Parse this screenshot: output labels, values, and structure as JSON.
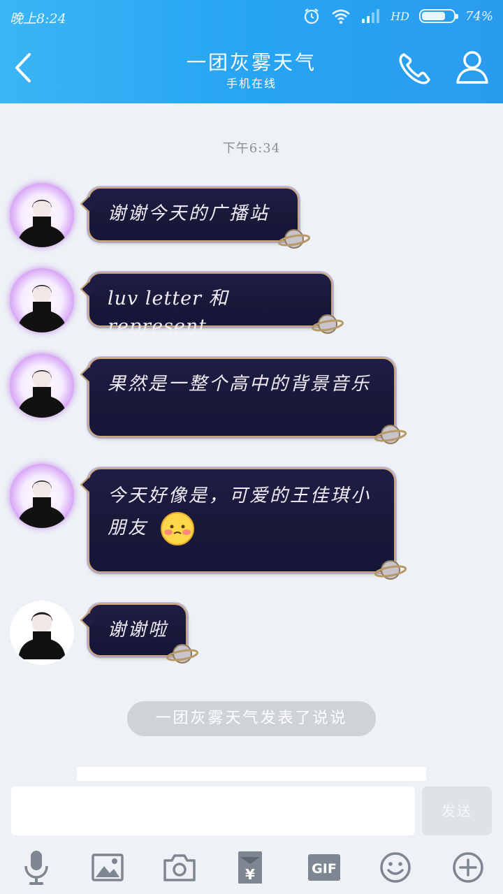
{
  "status_bar": {
    "time": "晚上8:24",
    "network": "HD",
    "battery_pct": "74%",
    "battery_level": 0.74
  },
  "header": {
    "title": "一团灰雾天气",
    "subtitle": "手机在线",
    "icons": [
      "back-chevron-icon",
      "phone-icon",
      "profile-icon"
    ]
  },
  "chat": {
    "timestamp": "下午6:34",
    "messages": [
      {
        "text": "谢谢今天的广播站"
      },
      {
        "text": "luv letter 和 represent"
      },
      {
        "text": "果然是一整个高中的背景音乐"
      },
      {
        "text": "今天好像是，可爱的王佳琪小朋友"
      },
      {
        "text": "谢谢啦"
      }
    ],
    "notice": "一团灰雾天气发表了说说"
  },
  "input": {
    "value": "",
    "send_label": "发送"
  },
  "toolbar": {
    "icons": [
      "microphone-icon",
      "image-icon",
      "camera-icon",
      "red-packet-icon",
      "gif-icon",
      "emoji-icon",
      "plus-icon"
    ],
    "gif_label": "GIF"
  },
  "colors": {
    "header": "#2aa6f4",
    "bubble_bg": "#1b1a40",
    "bubble_border": "#c9a67a",
    "notice_bg": "#cfd3d8"
  }
}
